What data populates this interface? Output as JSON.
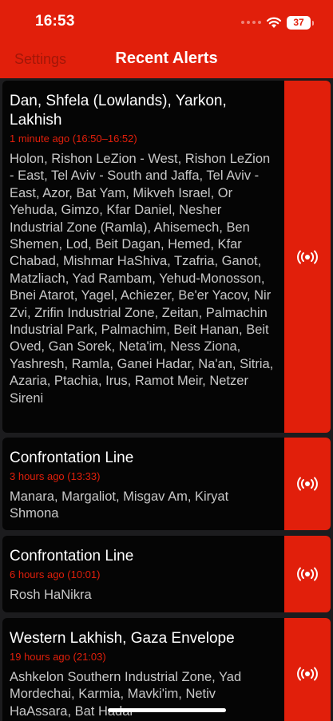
{
  "status_bar": {
    "time": "16:53",
    "battery": "37"
  },
  "nav": {
    "left_label": "Settings",
    "title": "Recent Alerts"
  },
  "colors": {
    "accent": "#e11f0b",
    "card_bg": "#050505",
    "list_bg": "#1c1c1e"
  },
  "alerts": [
    {
      "title": "Dan, Shfela (Lowlands), Yarkon, Lakhish",
      "time": "1 minute ago (16:50–16:52)",
      "areas": "Holon, Rishon LeZion - West, Rishon LeZion - East, Tel Aviv - South and Jaffa, Tel Aviv - East, Azor, Bat Yam, Mikveh Israel, Or Yehuda, Gimzo, Kfar Daniel, Nesher Industrial Zone (Ramla), Ahisemech, Ben Shemen, Lod, Beit Dagan, Hemed, Kfar Chabad, Mishmar HaShiva, Tzafria, Ganot, Matzliach, Yad Rambam, Yehud-Monosson, Bnei Atarot, Yagel, Achiezer, Be'er Yacov, Nir Zvi, Zrifin Industrial Zone, Zeitan, Palmachin Industrial Park, Palmachim, Beit Hanan, Beit Oved, Gan Sorek, Neta'im, Ness Ziona, Yashresh, Ramla, Ganei Hadar, Na'an, Sitria, Azaria, Ptachia, Irus, Ramot Meir, Netzer Sireni",
      "action_icon": "alert-broadcast-icon"
    },
    {
      "title": "Confrontation Line",
      "time": "3 hours ago (13:33)",
      "areas": "Manara, Margaliot, Misgav Am, Kiryat Shmona",
      "action_icon": "alert-broadcast-icon"
    },
    {
      "title": "Confrontation Line",
      "time": "6 hours ago (10:01)",
      "areas": "Rosh HaNikra",
      "action_icon": "alert-broadcast-icon"
    },
    {
      "title": "Western Lakhish, Gaza Envelope",
      "time": "19 hours ago (21:03)",
      "areas": "Ashkelon Southern Industrial Zone, Yad Mordechai, Karmia, Mavki'im, Netiv HaAssara, Bat Hadar",
      "action_icon": "alert-broadcast-icon"
    }
  ]
}
